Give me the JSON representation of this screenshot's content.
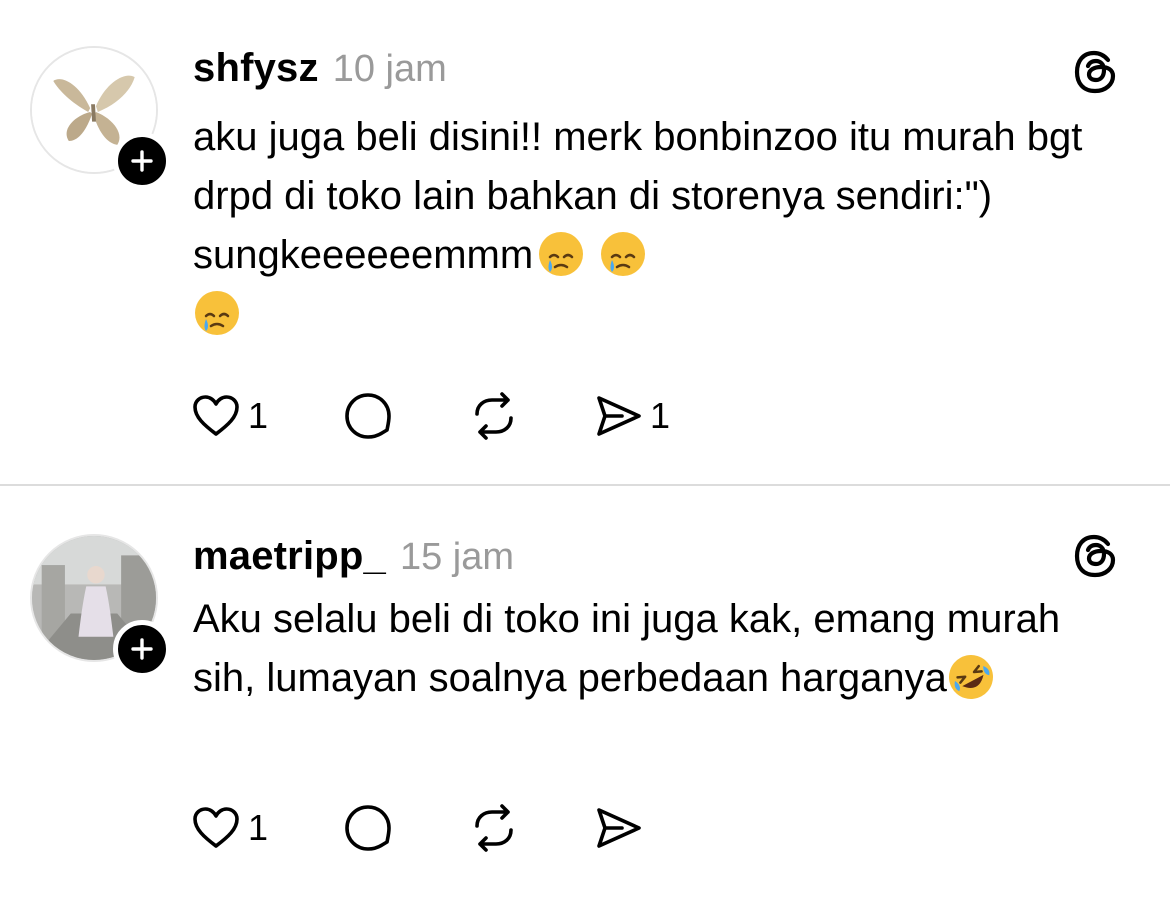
{
  "posts": [
    {
      "username": "shfysz",
      "time": "10 jam",
      "text": "aku juga beli disini!! merk bonbinzoo itu murah bgt drpd di toko lain bahkan di storenya sendiri:\") sungkeeeeeemmm",
      "emoji": [
        "face-holding-back-tears",
        "face-holding-back-tears",
        "face-holding-back-tears"
      ],
      "likes": "1",
      "shares": "1",
      "avatar": "butterfly-avatar"
    },
    {
      "username": "maetripp_",
      "time": "15 jam",
      "text": "Aku selalu beli di toko ini juga kak, emang murah sih, lumayan soalnya perbedaan harganya",
      "emoji": [
        "rolling-on-floor-laughing"
      ],
      "likes": "1",
      "avatar": "photo-avatar"
    }
  ],
  "colors": {
    "text": "#000000",
    "muted": "#9a9a9a",
    "divider": "#dcdcdc",
    "emoji_yellow": "#f8c13a"
  }
}
